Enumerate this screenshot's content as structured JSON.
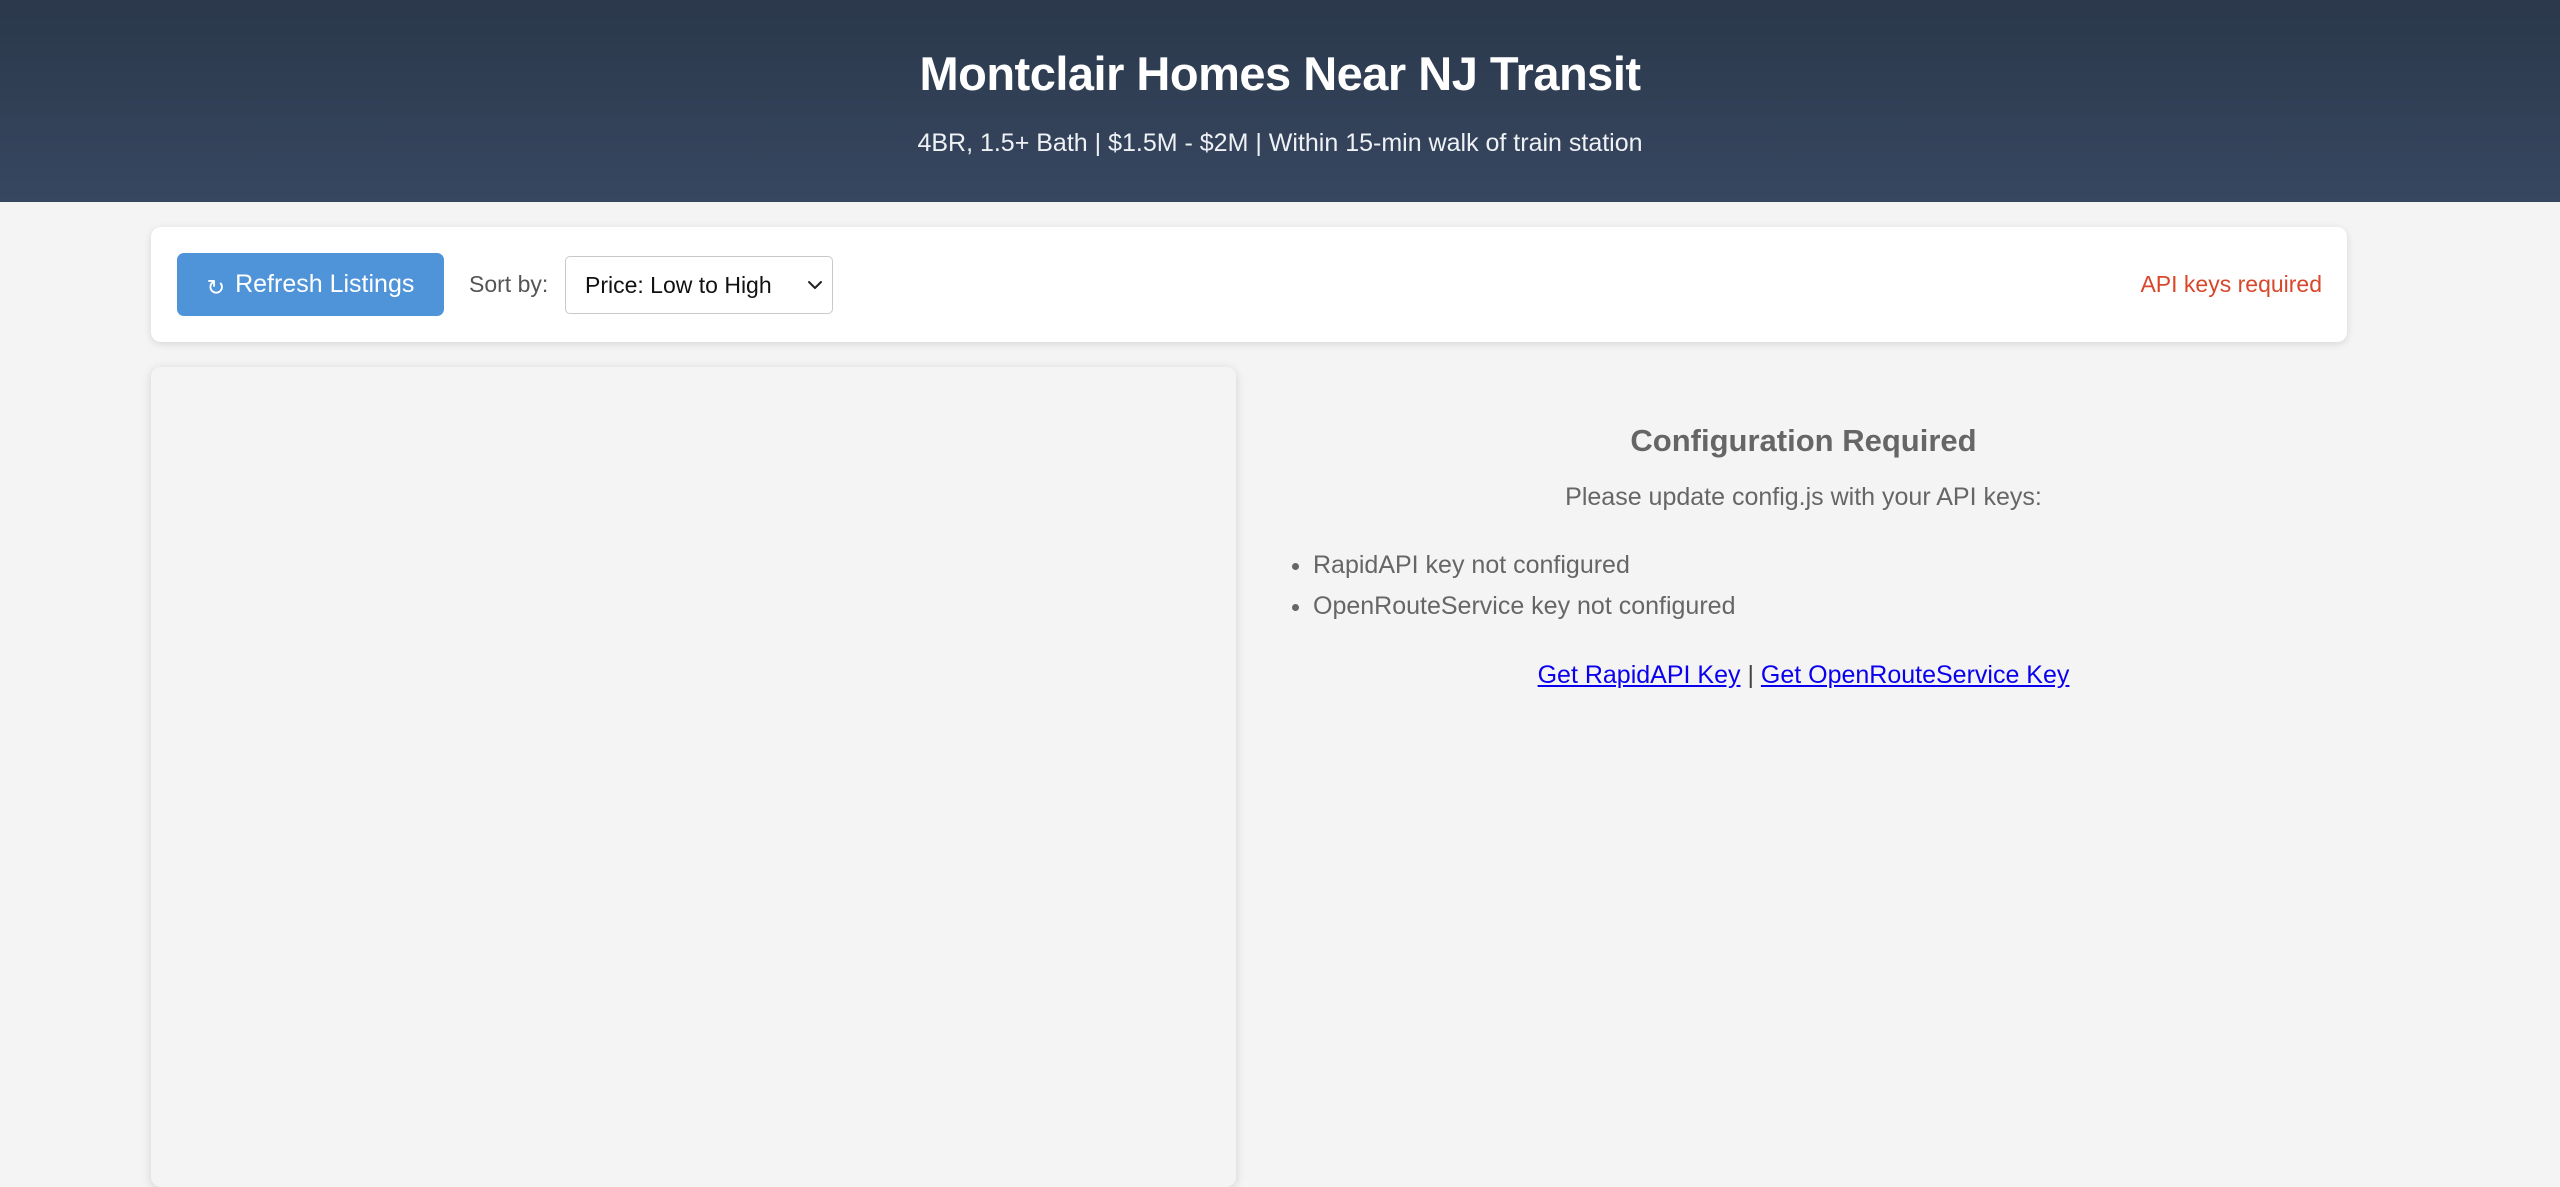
{
  "header": {
    "title": "Montclair Homes Near NJ Transit",
    "subtitle": "4BR, 1.5+ Bath | $1.5M - $2M | Within 15-min walk of train station"
  },
  "toolbar": {
    "refresh_icon": "refresh-icon",
    "refresh_icon_glyph": "↻",
    "refresh_label": "Refresh Listings",
    "sort_label": "Sort by:",
    "sort_selected": "Price: Low to High",
    "status_text": "API keys required",
    "status_color": "#d9472b",
    "button_color": "#4f94d8"
  },
  "config": {
    "title": "Configuration Required",
    "instructions": "Please update config.js with your API keys:",
    "issues": [
      "RapidAPI key not configured",
      "OpenRouteService key not configured"
    ],
    "link_rapidapi": "Get RapidAPI Key",
    "link_separator": "|",
    "link_openroute": "Get OpenRouteService Key"
  }
}
